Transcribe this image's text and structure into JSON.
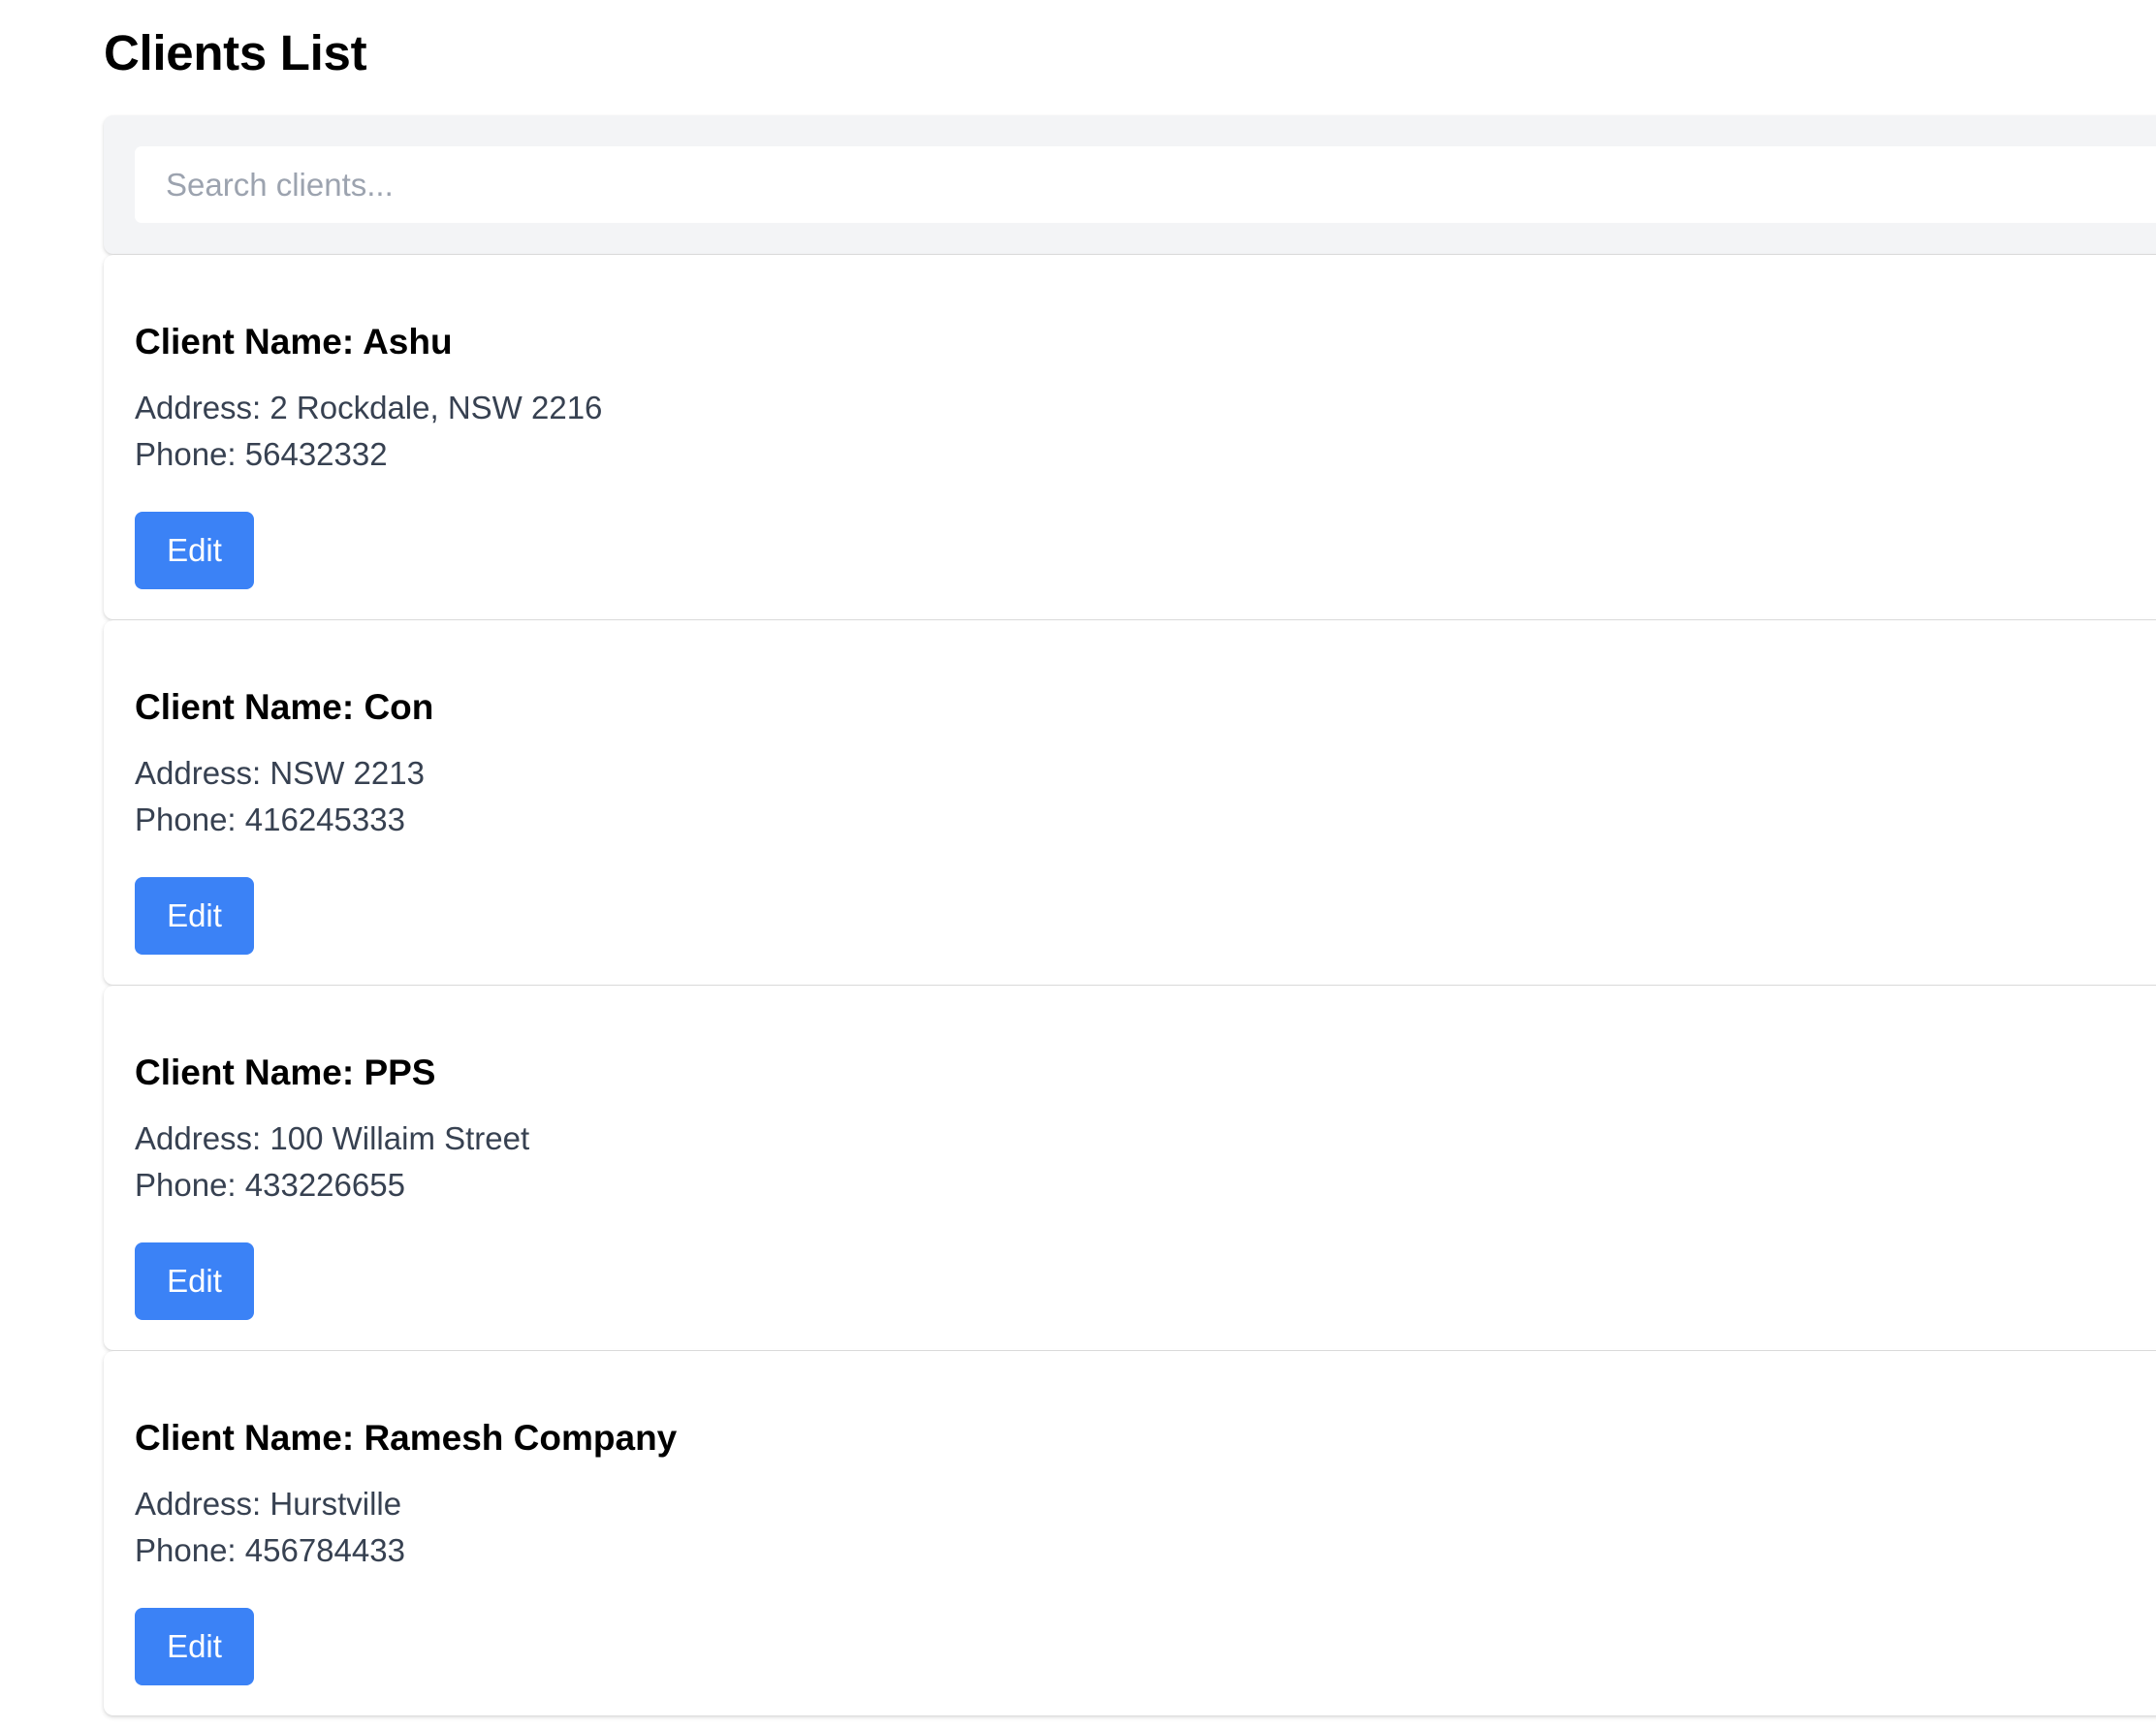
{
  "page": {
    "title": "Clients List"
  },
  "search": {
    "placeholder": "Search clients...",
    "value": ""
  },
  "clients": [
    {
      "name_label": "Client Name:",
      "name": "Ashu",
      "address": "Address: 2 Rockdale, NSW 2216",
      "phone": "Phone: 56432332",
      "edit_label": "Edit"
    },
    {
      "name_label": "Client Name:",
      "name": "Con",
      "address": "Address: NSW 2213",
      "phone": "Phone: 416245333",
      "edit_label": "Edit"
    },
    {
      "name_label": "Client Name:",
      "name": "PPS",
      "address": "Address: 100 Willaim Street",
      "phone": "Phone: 433226655",
      "edit_label": "Edit"
    },
    {
      "name_label": "Client Name:",
      "name": "Ramesh Company",
      "address": "Address: Hurstville",
      "phone": "Phone: 456784433",
      "edit_label": "Edit"
    }
  ],
  "colors": {
    "accent": "#3b82f6",
    "panel_bg": "#f3f4f6",
    "body_text": "#374151"
  }
}
